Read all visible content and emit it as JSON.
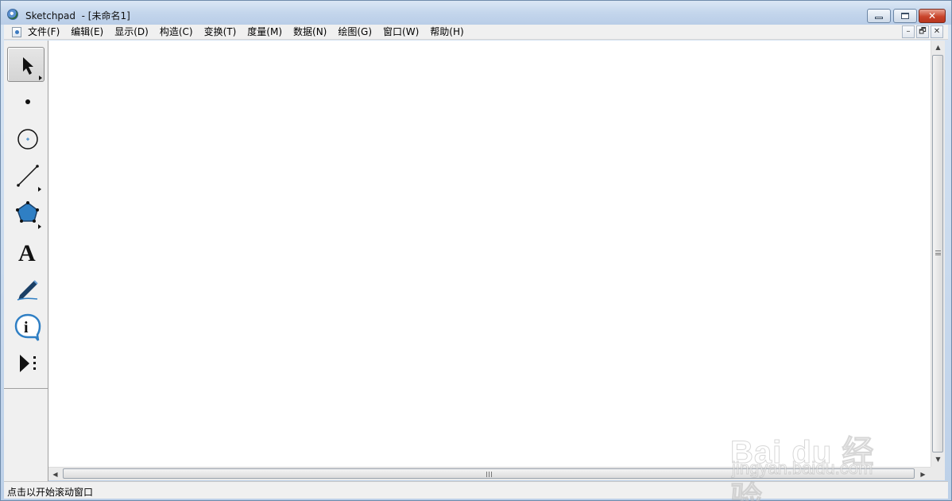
{
  "window": {
    "title": "Sketchpad  - [未命名1]",
    "app_icon": "sketchpad-app-icon",
    "controls": {
      "minimize": "minimize-icon",
      "maximize": "maximize-icon",
      "close": "✕"
    }
  },
  "menubar": {
    "doc_icon": "document-icon",
    "items": [
      "文件(F)",
      "编辑(E)",
      "显示(D)",
      "构造(C)",
      "变换(T)",
      "度量(M)",
      "数据(N)",
      "绘图(G)",
      "窗口(W)",
      "帮助(H)"
    ],
    "mdi_controls": {
      "minimize": "–",
      "restore": "🗗",
      "close": "✕"
    }
  },
  "toolbox": {
    "tools": [
      {
        "name": "arrow-tool-icon",
        "selected": true
      },
      {
        "name": "point-tool-icon",
        "selected": false
      },
      {
        "name": "compass-tool-icon",
        "selected": false
      },
      {
        "name": "straightedge-tool-icon",
        "selected": false
      },
      {
        "name": "polygon-tool-icon",
        "selected": false
      },
      {
        "name": "text-tool-icon",
        "label": "A",
        "selected": false
      },
      {
        "name": "marker-tool-icon",
        "selected": false
      },
      {
        "name": "information-tool-icon",
        "label": "i",
        "selected": false
      },
      {
        "name": "custom-tool-icon",
        "selected": false
      }
    ]
  },
  "scrollbars": {
    "vertical": {
      "up": "▲",
      "down": "▼"
    },
    "horizontal": {
      "left": "◀",
      "right": "▶"
    }
  },
  "status": {
    "text": "点击以开始滚动窗口"
  },
  "watermark": {
    "main": "Bai du 经验",
    "sub": "jingyan.baidu.com"
  },
  "colors": {
    "accent": "#2b6cb0",
    "polygon_fill": "#2f7fc4"
  }
}
